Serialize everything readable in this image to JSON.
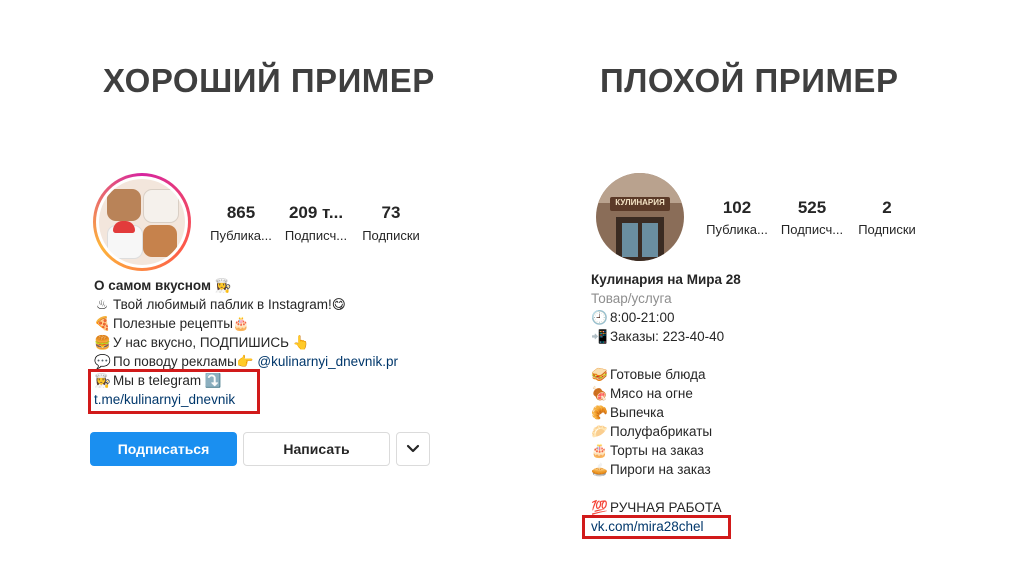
{
  "headings": {
    "good": "ХОРОШИЙ ПРИМЕР",
    "bad": "ПЛОХОЙ ПРИМЕР"
  },
  "good_profile": {
    "stats": [
      {
        "value": "865",
        "label": "Публика..."
      },
      {
        "value": "209 т...",
        "label": "Подписч..."
      },
      {
        "value": "73",
        "label": "Подписки"
      }
    ],
    "bio": {
      "name": "О самом вкусном",
      "name_emoji": "👩‍🍳",
      "lines": [
        {
          "icon": "♨",
          "text": "Твой любимый паблик в Instagram!",
          "tail": "😋"
        },
        {
          "icon": "🍕",
          "text": "Полезные рецепты",
          "tail": "🎂"
        },
        {
          "icon": "🍔",
          "text": "У нас вкусно, ПОДПИШИСЬ",
          "tail": "👆"
        },
        {
          "icon": "💬",
          "text": "По поводу рекламы",
          "tail": "👉",
          "mention": "@kulinarnyi_dnevnik.pr"
        }
      ],
      "telegram_line": {
        "icon": "👩‍🍳",
        "text": "Мы в telegram",
        "tail": "⤵️"
      },
      "link": "t.me/kulinarnyi_dnevnik"
    },
    "buttons": {
      "follow": "Подписаться",
      "message": "Написать",
      "more_icon": "chevron-down-icon"
    }
  },
  "bad_profile": {
    "avatar_sign": "КУЛИНАРИЯ",
    "stats": [
      {
        "value": "102",
        "label": "Публика..."
      },
      {
        "value": "525",
        "label": "Подписч..."
      },
      {
        "value": "2",
        "label": "Подписки"
      }
    ],
    "bio": {
      "name": "Кулинария на Мира 28",
      "category": "Товар/услуга",
      "hours": {
        "icon": "🕘",
        "text": "8:00-21:00"
      },
      "phone": {
        "icon": "📲",
        "text": "Заказы: 223-40-40"
      },
      "items": [
        {
          "icon": "🥪",
          "text": "Готовые блюда"
        },
        {
          "icon": "🍖",
          "text": "Мясо на огне"
        },
        {
          "icon": "🥐",
          "text": "Выпечка"
        },
        {
          "icon": "🥟",
          "text": "Полуфабрикаты"
        },
        {
          "icon": "🎂",
          "text": "Торты на заказ"
        },
        {
          "icon": "🥧",
          "text": "Пироги на заказ"
        }
      ],
      "handmade": {
        "icon": "💯",
        "text": "РУЧНАЯ РАБОТА"
      },
      "link": "vk.com/mira28chel"
    }
  },
  "colors": {
    "accent_blue": "#1a8ff0",
    "highlight_red": "#d11a1a",
    "link": "#00376b"
  }
}
